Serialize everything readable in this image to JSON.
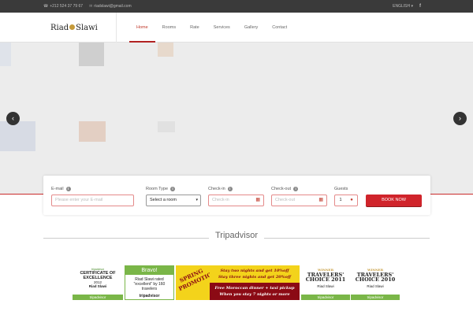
{
  "topbar": {
    "phone": "+212 524 37 79 67",
    "email": "riadslawi@gmail.com",
    "language": "ENGLISH",
    "language_caret": "▾",
    "social": "f"
  },
  "nav": {
    "logo_left": "Riad",
    "logo_right": "Slawi",
    "items": [
      "Home",
      "Rooms",
      "Rate",
      "Services",
      "Gallery",
      "Contact"
    ],
    "active": "Home"
  },
  "slider": {
    "prev": "‹",
    "next": "›"
  },
  "booking": {
    "email_label": "E-mail",
    "email_placeholder": "Please enter your E-mail",
    "room_label": "Room Type",
    "room_value": "Select a room",
    "checkin_label": "Check-in",
    "checkin_placeholder": "Check-in",
    "checkout_label": "Check-out",
    "checkout_placeholder": "Check-out",
    "guests_label": "Guests",
    "guests_value": "1",
    "book_button": "BOOK NOW",
    "info_glyph": "i",
    "calendar_glyph": "▦",
    "caret_glyph": "▾",
    "person_glyph": "●"
  },
  "tripadvisor": {
    "heading": "Tripadvisor",
    "badge1": {
      "top": "tripadvisor",
      "line1": "CERTIFICATE OF",
      "line2": "EXCELLENCE",
      "year": "2012",
      "name": "Riad Slawi",
      "logo": "tripadvisor"
    },
    "badge2": {
      "header": "Bravo!",
      "line1": "Riad Slawi rated",
      "line2": "\"excellent\" by 160",
      "line3": "travelers",
      "logo": "tripadvisor"
    },
    "badge3": {
      "line1": "SPRING",
      "line2": "PROMOTION"
    },
    "badge4": {
      "line1": "Stay two nights and get 10%off",
      "line2": "Stay three nights and get 20%off",
      "line3": "Free Moroccan dinner + taxi pickup",
      "line4": "When you stay 7 nights or more"
    },
    "badge5": {
      "winner": "WINNER",
      "line1": "TRAVELERS'",
      "line2": "CHOICE 2011",
      "name": "Riad Slawi",
      "logo": "tripadvisor"
    },
    "badge6": {
      "winner": "WINNER",
      "line1": "TRAVELERS'",
      "line2": "CHOICE 2010",
      "name": "Riad Slawi",
      "logo": "tripadvisor"
    }
  },
  "colors": {
    "accent": "#c92b2b",
    "topbar": "#3a3a3a",
    "ta_green": "#7ab648"
  }
}
